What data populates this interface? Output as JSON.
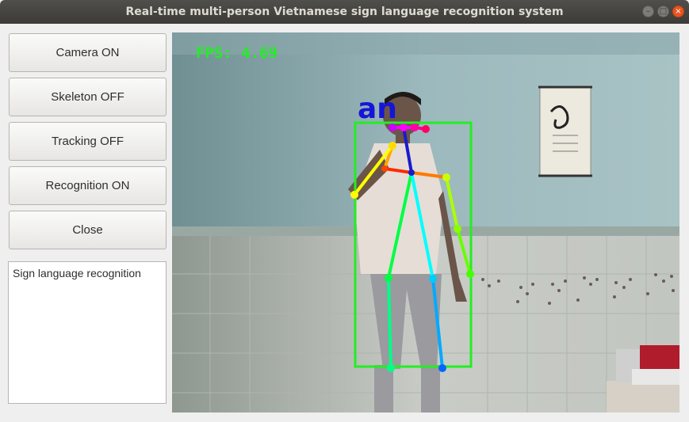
{
  "window": {
    "title": "Real-time multi-person Vietnamese sign language recognition system",
    "controls": [
      "minimize-icon",
      "maximize-icon",
      "close-icon"
    ]
  },
  "buttons": {
    "camera": "Camera ON",
    "skeleton": "Skeleton OFF",
    "tracking": "Tracking OFF",
    "recognition": "Recognition ON",
    "close": "Close"
  },
  "output": {
    "text": "Sign language recognition"
  },
  "video": {
    "fps_label": "FPS: 4.69",
    "detected_sign": "an",
    "colors": {
      "fps": "#22ee22",
      "bbox": "#22ee22",
      "sign_label": "#1515d8"
    }
  }
}
